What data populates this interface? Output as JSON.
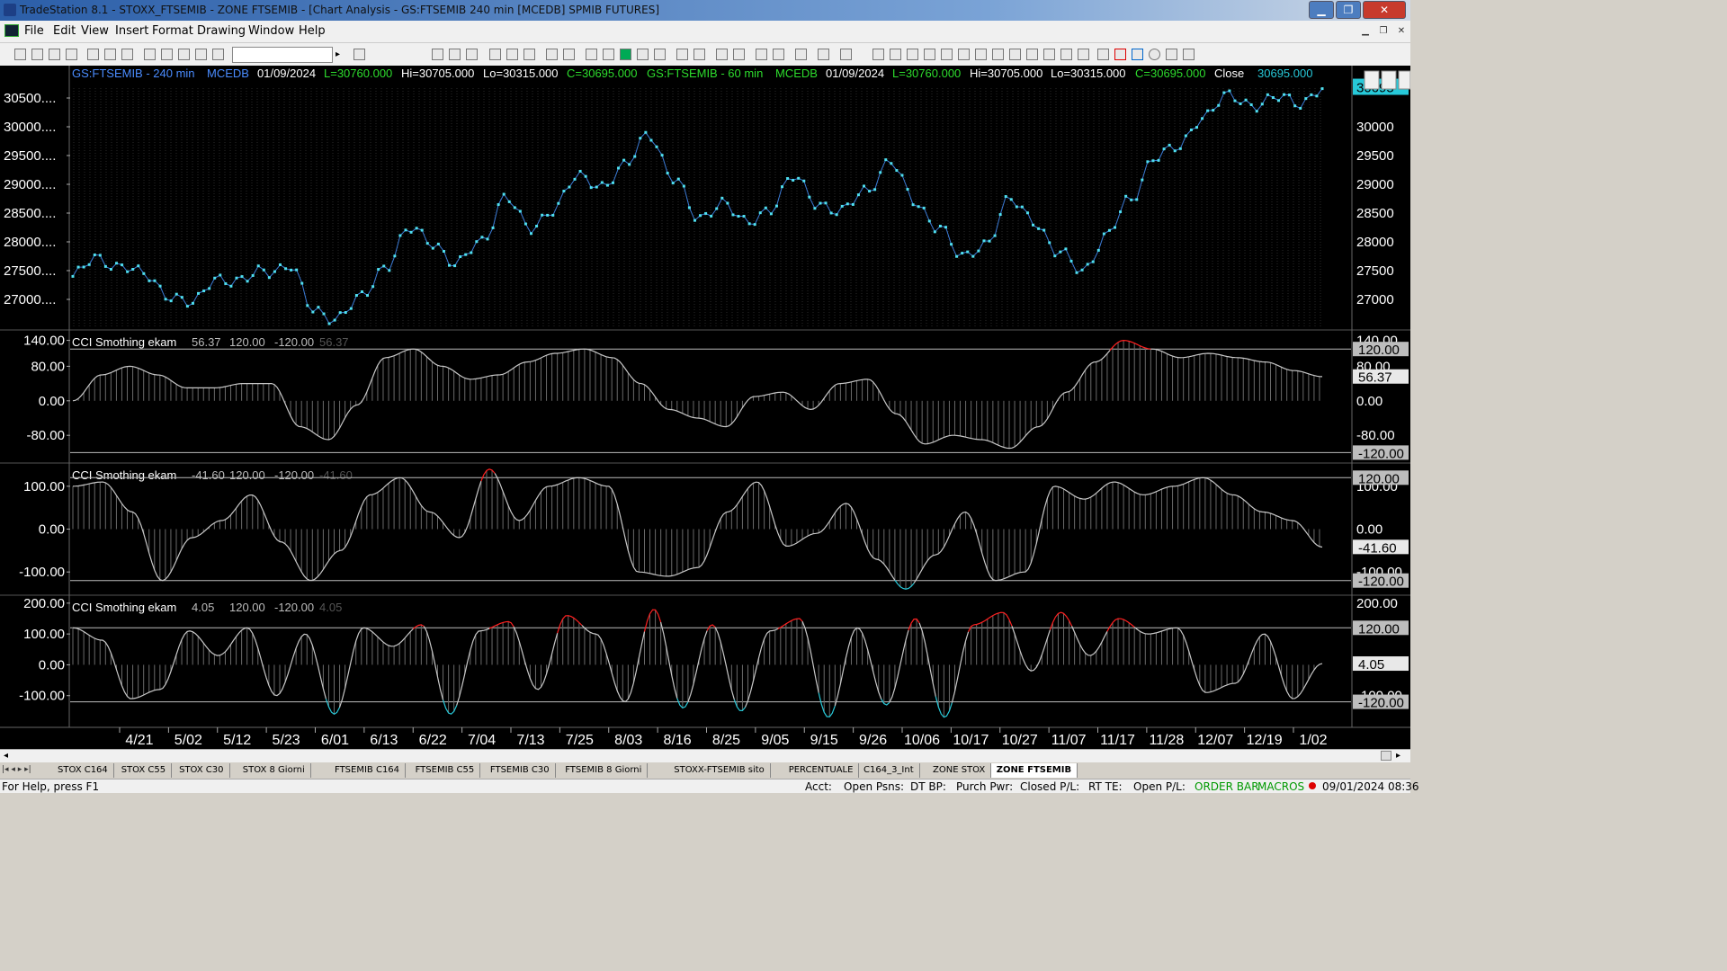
{
  "window": {
    "title": "TradeStation 8.1 - STOXX_FTSEMIB - ZONE FTSEMIB - [Chart Analysis - GS:FTSEMIB  240 min  [MCEDB] SPMIB FUTURES]",
    "minimize": "▁",
    "restore": "❐",
    "close": "✕"
  },
  "menu": [
    "File",
    "Edit",
    "View",
    "Insert",
    "Format",
    "Drawing",
    "Window",
    "Help"
  ],
  "chart": {
    "header": {
      "sym1": "GS:FTSEMIB - 240 min",
      "src1": "MCEDB",
      "date1": "01/09/2024",
      "last1": "L=30760.000",
      "hi1": "Hi=30705.000",
      "lo1": "Lo=30315.000",
      "close1": "C=30695.000",
      "sym2": "GS:FTSEMIB - 60 min",
      "src2": "MCEDB",
      "date2": "01/09/2024",
      "last2": "L=30760.000",
      "hi2": "Hi=30705.000",
      "lo2": "Lo=30315.000",
      "close2": "C=30695.000",
      "close_label": "Close",
      "close_value": "30695.000"
    },
    "price_left_ticks": [
      "30500....",
      "30000....",
      "29500....",
      "29000....",
      "28500....",
      "28000....",
      "27500....",
      "27000...."
    ],
    "price_right_ticks": [
      "30000",
      "29500",
      "29000",
      "28500",
      "28000",
      "27500",
      "27000"
    ],
    "last_price_tag": "30695",
    "x_ticks": [
      "4/21",
      "5/02",
      "5/12",
      "5/23",
      "6/01",
      "6/13",
      "6/22",
      "7/04",
      "7/13",
      "7/25",
      "8/03",
      "8/16",
      "8/25",
      "9/05",
      "9/15",
      "9/26",
      "10/06",
      "10/17",
      "10/27",
      "11/07",
      "11/17",
      "11/28",
      "12/07",
      "12/19",
      "1/02"
    ],
    "indicators": [
      {
        "label": "CCI Smothing ekam",
        "value": "56.37",
        "upper": "120.00",
        "lower": "-120.00",
        "ghost": "56.37",
        "left_ticks": [
          "140.00",
          "80.00",
          "0.00",
          "-80.00"
        ],
        "right_ticks": [
          "140.00",
          "80.00",
          "0.00",
          "-80.00"
        ],
        "tags": [
          "120.00",
          "56.37",
          "-120.00"
        ]
      },
      {
        "label": "CCI Smothing ekam",
        "value": "-41.60",
        "upper": "120.00",
        "lower": "-120.00",
        "ghost": "-41.60",
        "left_ticks": [
          "100.00",
          "0.00",
          "-100.00"
        ],
        "right_ticks": [
          "100.00",
          "0.00",
          "-100.00"
        ],
        "tags": [
          "120.00",
          "-41.60",
          "-120.00"
        ]
      },
      {
        "label": "CCI Smothing ekam",
        "value": "4.05",
        "upper": "120.00",
        "lower": "-120.00",
        "ghost": "4.05",
        "left_ticks": [
          "200.00",
          "100.00",
          "0.00",
          "-100.00"
        ],
        "right_ticks": [
          "200.00",
          "-100.00"
        ],
        "tags": [
          "120.00",
          "4.05",
          "-120.00"
        ]
      }
    ]
  },
  "chart_data": [
    {
      "type": "line",
      "series": [
        {
          "values": [
            27400,
            27700,
            27600,
            27400,
            27100,
            26900,
            27400,
            27300,
            27500,
            27600,
            26800,
            26700,
            27000,
            27600,
            28200,
            28000,
            27600,
            28000,
            28800,
            28200,
            28600,
            29100,
            29000,
            29300,
            29900,
            29100,
            28400,
            28700,
            28300,
            28600,
            29100,
            28700,
            28500,
            28900,
            29400,
            28700,
            28300,
            27700,
            28000,
            28700,
            28400,
            27800,
            27500,
            28100,
            28700,
            29500,
            29600,
            30200,
            30500,
            30400,
            30500,
            30400,
            30700
          ]
        }
      ],
      "ylim": [
        26500,
        30750
      ]
    },
    {
      "type": "line",
      "series": [
        {
          "values": [
            0,
            60,
            80,
            60,
            30,
            30,
            40,
            40,
            -60,
            -90,
            -10,
            100,
            120,
            80,
            50,
            60,
            90,
            110,
            120,
            100,
            40,
            -20,
            -40,
            -60,
            10,
            20,
            -20,
            40,
            50,
            -30,
            -100,
            -80,
            -90,
            -110,
            -60,
            20,
            90,
            140,
            120,
            100,
            110,
            100,
            90,
            70,
            56
          ]
        }
      ],
      "ylim": [
        -140,
        160
      ]
    },
    {
      "type": "line",
      "series": [
        {
          "values": [
            100,
            110,
            40,
            -120,
            -20,
            20,
            80,
            -30,
            -120,
            -50,
            80,
            120,
            40,
            -20,
            140,
            20,
            100,
            120,
            100,
            -100,
            -110,
            -90,
            40,
            110,
            -40,
            -10,
            60,
            -70,
            -140,
            -60,
            40,
            -120,
            -100,
            100,
            70,
            110,
            80,
            100,
            120,
            80,
            40,
            20,
            -42
          ]
        }
      ],
      "ylim": [
        -150,
        150
      ]
    },
    {
      "type": "line",
      "series": [
        {
          "values": [
            120,
            80,
            -110,
            -80,
            110,
            30,
            120,
            -100,
            100,
            -160,
            120,
            60,
            130,
            -160,
            110,
            140,
            -80,
            160,
            100,
            -120,
            180,
            -140,
            130,
            -150,
            110,
            150,
            -170,
            120,
            -130,
            150,
            -170,
            130,
            170,
            -20,
            170,
            30,
            150,
            100,
            120,
            -90,
            -60,
            100,
            -110,
            4
          ]
        }
      ],
      "ylim": [
        -200,
        220
      ]
    }
  ],
  "tabs": [
    "STOX C164",
    "STOX C55",
    "STOX  C30",
    "STOX  8 Giorni",
    "FTSEMIB C164",
    "FTSEMIB C55",
    "FTSEMIB C30",
    "FTSEMIB  8 Giorni",
    "STOXX-FTSEMIB sito",
    "PERCENTUALE",
    "C164_3_Int",
    "ZONE STOX",
    "ZONE FTSEMIB"
  ],
  "status": {
    "help": "For Help, press F1",
    "acct": "Acct:",
    "open_psns": "Open Psns:",
    "dt_bp": "DT BP:",
    "purch_pwr": "Purch Pwr:",
    "closed_pl": "Closed P/L:",
    "rt_te": "RT TE:",
    "open_pl": "Open P/L:",
    "order_bar": "ORDER BAR",
    "macros": "MACROS",
    "datetime": "09/01/2024 08:36"
  },
  "colors": {
    "price_line": "#4fe0f0",
    "indicator_line": "#c8c8c8",
    "overbought": "#ff2020",
    "oversold": "#27c9d9",
    "header_blue": "#4a8cff",
    "header_green": "#2ddc2d",
    "header_white": "#ffffff"
  }
}
